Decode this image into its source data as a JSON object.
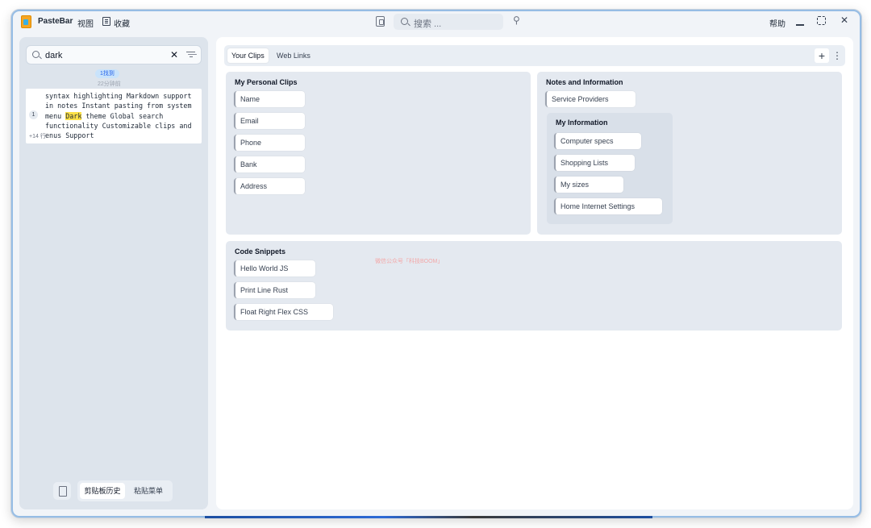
{
  "app": {
    "name": "PasteBar"
  },
  "menu": {
    "view": "视图",
    "favorites": "收藏"
  },
  "toolbar": {
    "search_placeholder": "搜索 ...",
    "slash_shortcut": "/",
    "help": "帮助"
  },
  "icons": {
    "app_logo": "clipboard-logo-icon",
    "favorites": "book-icon",
    "copy": "copy-icon",
    "search": "search-icon",
    "pin": "pin-icon",
    "minimize": "minimize-icon",
    "maximize": "maximize-icon",
    "close": "close-icon",
    "clear": "x-icon",
    "filter": "filter-icon",
    "clipboard": "clipboard-icon",
    "plus": "plus-icon",
    "more": "more-vertical-icon"
  },
  "colors": {
    "highlight": "#fde047",
    "badge_bg": "#c9e3fb",
    "badge_text": "#2563eb",
    "accent_border": "#4b8fd6"
  },
  "history": {
    "search_value": "dark",
    "found_label": "1找到",
    "time_ago": "22分钟前",
    "clip": {
      "index": "1",
      "more_lines": "+14 行",
      "line1": "syntax highlighting Markdown support",
      "line2": "in notes Instant pasting from system",
      "line3_before": "menu ",
      "line3_match": "Dark",
      "line3_after": " theme Global search",
      "line4": "functionality Customizable clips and",
      "line5": "enus Support"
    },
    "bottom_tabs": {
      "active": "剪贴板历史",
      "other": "粘贴菜单"
    }
  },
  "main": {
    "tabs": [
      {
        "label": "Your Clips"
      },
      {
        "label": "Web Links"
      }
    ],
    "plus": "+",
    "more": "⋮",
    "boards": {
      "personal": {
        "title": "My Personal Clips",
        "clips": [
          "Name",
          "Email",
          "Phone",
          "Bank",
          "Address"
        ]
      },
      "notes": {
        "title": "Notes and Information",
        "clips": [
          "Service Providers"
        ],
        "sub": {
          "title": "My Information",
          "clips": [
            "Computer specs",
            "Shopping Lists",
            "My sizes",
            "Home Internet Settings"
          ]
        }
      },
      "code": {
        "title": "Code Snippets",
        "clips": [
          "Hello World JS",
          "Print Line Rust",
          "Float Right Flex CSS"
        ]
      }
    },
    "watermark": "微信公众号「科技BOOM」"
  }
}
